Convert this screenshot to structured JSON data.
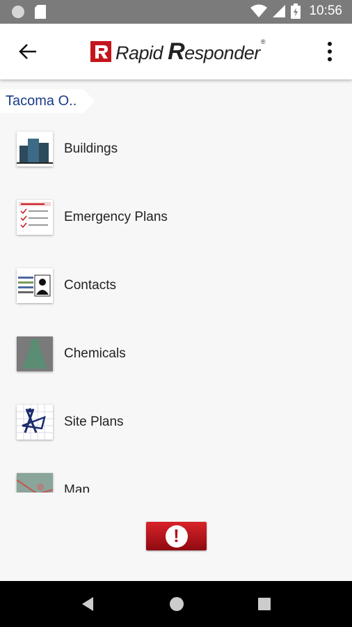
{
  "status_bar": {
    "time": "10:56"
  },
  "app_bar": {
    "logo_text_1": "Rapid",
    "logo_text_2": "R",
    "logo_text_3": "esponder",
    "reg_mark": "®"
  },
  "breadcrumb": {
    "label": "Tacoma O.."
  },
  "menu": {
    "items": [
      {
        "label": "Buildings",
        "icon": "buildings-icon"
      },
      {
        "label": "Emergency Plans",
        "icon": "emergency-plans-icon"
      },
      {
        "label": "Contacts",
        "icon": "contacts-icon"
      },
      {
        "label": "Chemicals",
        "icon": "chemicals-icon"
      },
      {
        "label": "Site Plans",
        "icon": "site-plans-icon"
      },
      {
        "label": "Map",
        "icon": "map-icon"
      }
    ]
  },
  "alert": {
    "symbol": "!"
  },
  "colors": {
    "brand_red": "#c4161c",
    "breadcrumb_text": "#1a3c8a"
  }
}
